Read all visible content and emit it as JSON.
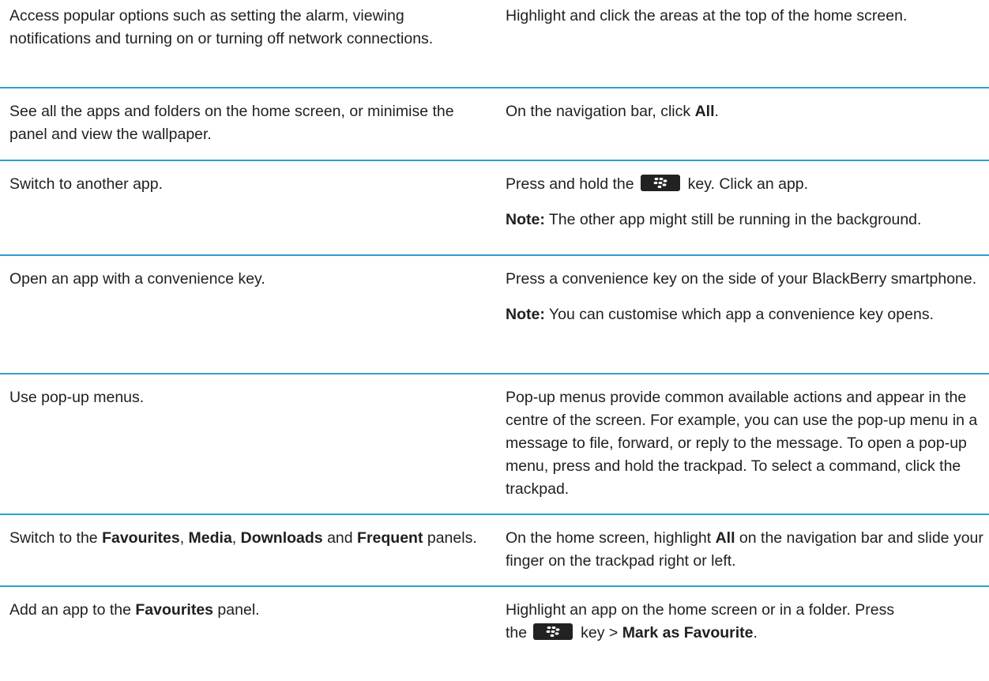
{
  "rows": [
    {
      "task": "Access popular options such as setting the alarm, viewing notifications and turning on or turning off network connections.",
      "action": "Highlight and click the areas at the top of the home screen."
    },
    {
      "task": "See all the apps and folders on the home screen, or minimise the panel and view the wallpaper.",
      "action_pre": "On the navigation bar, click ",
      "action_bold": "All",
      "action_post": "."
    },
    {
      "task": "Switch to another app.",
      "action_pre": "Press and hold the",
      "action_key_icon": "blackberry-menu-key-icon",
      "action_post": "key. Click an app.",
      "note_label": "Note:",
      "note_text": " The other app might still be running in the background."
    },
    {
      "task": "Open an app with a convenience key.",
      "action": "Press a convenience key on the side of your BlackBerry smartphone.",
      "note_label": "Note:",
      "note_text": " You can customise which app a convenience key opens."
    },
    {
      "task": "Use pop-up menus.",
      "action": "Pop-up menus provide common available actions and appear in the centre of the screen. For example, you can use the pop-up menu in a message to file, forward, or reply to the message. To open a pop-up menu, press and hold the trackpad. To select a command, click the trackpad."
    },
    {
      "task_pre": "Switch to the ",
      "task_b1": "Favourites",
      "task_s1": ", ",
      "task_b2": "Media",
      "task_s2": ", ",
      "task_b3": "Downloads",
      "task_s3": " and ",
      "task_b4": "Frequent",
      "task_post": " panels.",
      "action_pre": "On the home screen, highlight ",
      "action_bold": "All",
      "action_post": " on the navigation bar and slide your finger on the trackpad right or left."
    },
    {
      "task_pre": "Add an app to the ",
      "task_bold": "Favourites",
      "task_post": " panel.",
      "action_pre": "Highlight an app on the home screen or in a folder. Press the",
      "action_key_icon": "blackberry-menu-key-icon",
      "action_mid": "key > ",
      "action_bold": "Mark as Favourite",
      "action_post": "."
    }
  ],
  "colors": {
    "divider": "#2f9ed4",
    "text": "#1f1f1f",
    "key_bg": "#222222"
  }
}
